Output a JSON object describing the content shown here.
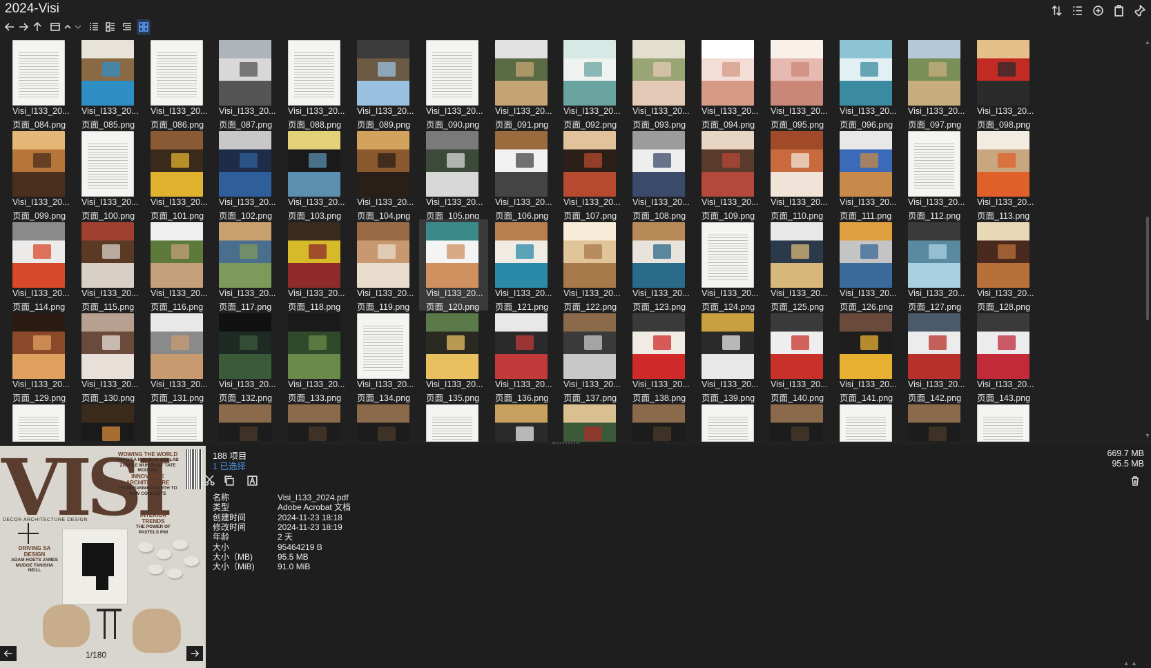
{
  "window": {
    "title": "2024-Visi"
  },
  "toolbar_icons": [
    "sort-icon",
    "details-view-icon",
    "add-icon",
    "clipboard-icon",
    "pin-icon"
  ],
  "nav_icons": [
    "back-icon",
    "forward-icon",
    "up-icon",
    "folder-icon",
    "chevron-up-icon",
    "chevron-down-icon",
    "list-view-icon",
    "tile-view-icon",
    "tree-view-icon",
    "thumbnail-view-icon"
  ],
  "grid": {
    "rows": [
      [
        {
          "name": "Visi_I133_20...",
          "sub": "页面_084.png",
          "kind": "doc"
        },
        {
          "name": "Visi_I133_20...",
          "sub": "页面_085.png",
          "kind": "pool"
        },
        {
          "name": "Visi_I133_20...",
          "sub": "页面_086.png",
          "kind": "doc"
        },
        {
          "name": "Visi_I133_20...",
          "sub": "页面_087.png",
          "kind": "cars"
        },
        {
          "name": "Visi_I133_20...",
          "sub": "页面_088.png",
          "kind": "doc2"
        },
        {
          "name": "Visi_I133_20...",
          "sub": "页面_089.png",
          "kind": "house"
        },
        {
          "name": "Visi_I133_20...",
          "sub": "页面_090.png",
          "kind": "doc"
        },
        {
          "name": "Visi_I133_20...",
          "sub": "页面_091.png",
          "kind": "aerial"
        },
        {
          "name": "Visi_I133_20...",
          "sub": "页面_092.png",
          "kind": "vases"
        },
        {
          "name": "Visi_I133_20...",
          "sub": "页面_093.png",
          "kind": "green"
        },
        {
          "name": "Visi_I133_20...",
          "sub": "页面_094.png",
          "kind": "pink"
        },
        {
          "name": "Visi_I133_20...",
          "sub": "页面_095.png",
          "kind": "pinkroom"
        },
        {
          "name": "Visi_I133_20...",
          "sub": "页面_096.png",
          "kind": "teal"
        },
        {
          "name": "Visi_I133_20...",
          "sub": "页面_097.png",
          "kind": "landscape"
        },
        {
          "name": "Visi_I133_20...",
          "sub": "页面_098.png",
          "kind": "red"
        }
      ],
      [
        {
          "name": "Visi_I133_20...",
          "sub": "页面_099.png",
          "kind": "warm"
        },
        {
          "name": "Visi_I133_20...",
          "sub": "页面_100.png",
          "kind": "doc"
        },
        {
          "name": "Visi_I133_20...",
          "sub": "页面_101.png",
          "kind": "yellowdesk"
        },
        {
          "name": "Visi_I133_20...",
          "sub": "页面_102.png",
          "kind": "blue"
        },
        {
          "name": "Visi_I133_20...",
          "sub": "页面_103.png",
          "kind": "fridge"
        },
        {
          "name": "Visi_I133_20...",
          "sub": "页面_104.png",
          "kind": "lounge"
        },
        {
          "name": "Visi_I133_20...",
          "sub": "页面_105.png",
          "kind": "stairs"
        },
        {
          "name": "Visi_I133_20...",
          "sub": "页面_106.png",
          "kind": "collage"
        },
        {
          "name": "Visi_I133_20...",
          "sub": "页面_107.png",
          "kind": "dining"
        },
        {
          "name": "Visi_I133_20...",
          "sub": "页面_108.png",
          "kind": "collage2"
        },
        {
          "name": "Visi_I133_20...",
          "sub": "页面_109.png",
          "kind": "bedroom"
        },
        {
          "name": "Visi_I133_20...",
          "sub": "页面_110.png",
          "kind": "terracotta"
        },
        {
          "name": "Visi_I133_20...",
          "sub": "页面_111.png",
          "kind": "sky"
        },
        {
          "name": "Visi_I133_20...",
          "sub": "页面_112.png",
          "kind": "doc"
        },
        {
          "name": "Visi_I133_20...",
          "sub": "页面_113.png",
          "kind": "orange"
        }
      ],
      [
        {
          "name": "Visi_I133_20...",
          "sub": "页面_114.png",
          "kind": "white"
        },
        {
          "name": "Visi_I133_20...",
          "sub": "页面_115.png",
          "kind": "living"
        },
        {
          "name": "Visi_I133_20...",
          "sub": "页面_116.png",
          "kind": "garden"
        },
        {
          "name": "Visi_I133_20...",
          "sub": "页面_117.png",
          "kind": "exterior"
        },
        {
          "name": "Visi_I133_20...",
          "sub": "页面_118.png",
          "kind": "yellowred"
        },
        {
          "name": "Visi_I133_20...",
          "sub": "页面_119.png",
          "kind": "wood"
        },
        {
          "name": "Visi_I133_20...",
          "sub": "页面_120.png",
          "kind": "collage3",
          "selected": true
        },
        {
          "name": "Visi_I133_20...",
          "sub": "页面_121.png",
          "kind": "bright"
        },
        {
          "name": "Visi_I133_20...",
          "sub": "页面_122.png",
          "kind": "spiral"
        },
        {
          "name": "Visi_I133_20...",
          "sub": "页面_123.png",
          "kind": "bluechairs"
        },
        {
          "name": "Visi_I133_20...",
          "sub": "页面_124.png",
          "kind": "doc"
        },
        {
          "name": "Visi_I133_20...",
          "sub": "页面_125.png",
          "kind": "round"
        },
        {
          "name": "Visi_I133_20...",
          "sub": "页面_126.png",
          "kind": "modern"
        },
        {
          "name": "Visi_I133_20...",
          "sub": "页面_127.png",
          "kind": "pool2"
        },
        {
          "name": "Visi_I133_20...",
          "sub": "页面_128.png",
          "kind": "shelves"
        }
      ],
      [
        {
          "name": "Visi_I133_20...",
          "sub": "页面_129.png",
          "kind": "corridor"
        },
        {
          "name": "Visi_I133_20...",
          "sub": "页面_130.png",
          "kind": "bath"
        },
        {
          "name": "Visi_I133_20...",
          "sub": "页面_131.png",
          "kind": "shower"
        },
        {
          "name": "Visi_I133_20...",
          "sub": "页面_132.png",
          "kind": "darkgarden"
        },
        {
          "name": "Visi_I133_20...",
          "sub": "页面_133.png",
          "kind": "trees"
        },
        {
          "name": "Visi_I133_20...",
          "sub": "页面_134.png",
          "kind": "doc"
        },
        {
          "name": "Visi_I133_20...",
          "sub": "页面_135.png",
          "kind": "night"
        },
        {
          "name": "Visi_I133_20...",
          "sub": "页面_136.png",
          "kind": "redfloor"
        },
        {
          "name": "Visi_I133_20...",
          "sub": "页面_137.png",
          "kind": "loft"
        },
        {
          "name": "Visi_I133_20...",
          "sub": "页面_138.png",
          "kind": "redstools"
        },
        {
          "name": "Visi_I133_20...",
          "sub": "页面_139.png",
          "kind": "loft2"
        },
        {
          "name": "Visi_I133_20...",
          "sub": "页面_140.png",
          "kind": "gallery"
        },
        {
          "name": "Visi_I133_20...",
          "sub": "页面_141.png",
          "kind": "spiral2"
        },
        {
          "name": "Visi_I133_20...",
          "sub": "页面_142.png",
          "kind": "collage4"
        },
        {
          "name": "Visi_I133_20...",
          "sub": "页面_143.png",
          "kind": "redbed"
        }
      ],
      [
        {
          "name": "",
          "sub": "",
          "kind": "doc"
        },
        {
          "name": "",
          "sub": "",
          "kind": "darkchandelier"
        },
        {
          "name": "",
          "sub": "",
          "kind": "doc"
        },
        {
          "name": "",
          "sub": "",
          "kind": "dark"
        },
        {
          "name": "",
          "sub": "",
          "kind": "dark"
        },
        {
          "name": "",
          "sub": "",
          "kind": "dark"
        },
        {
          "name": "",
          "sub": "",
          "kind": "doc"
        },
        {
          "name": "",
          "sub": "",
          "kind": "lamp"
        },
        {
          "name": "",
          "sub": "",
          "kind": "greenred"
        },
        {
          "name": "",
          "sub": "",
          "kind": "dark"
        },
        {
          "name": "",
          "sub": "",
          "kind": "doc"
        },
        {
          "name": "",
          "sub": "",
          "kind": "dark"
        },
        {
          "name": "",
          "sub": "",
          "kind": "doc"
        },
        {
          "name": "",
          "sub": "",
          "kind": "dark"
        },
        {
          "name": "",
          "sub": "",
          "kind": "doc"
        }
      ]
    ]
  },
  "preview": {
    "cover": {
      "logo": "VISI",
      "headline1": "WOWING THE WORLD",
      "headline1_sub": "THABISA MJO/DAG COLLAB ZANELE MUHOLI AT TATE MODERN",
      "headline2": "INNOVATIVE ARCHITECTURE",
      "headline2_sub": "FROM RAMMED EARTH TO RAW CONCRETE",
      "tagline": "DECOR ARCHITECTURE DESIGN",
      "headline3": "INTERIOR TRENDS",
      "headline3_sub": "THE POWER OF PASTELS P90",
      "headline4": "DRIVING SA DESIGN",
      "headline4_sub": "ADAM HOETS JAMES MUDGE TANISHA NEILL"
    },
    "page_counter": "1/180"
  },
  "info": {
    "item_count": "188 项目",
    "selected_count": "1 已选择",
    "total_size": "669.7 MB",
    "selected_size": "95.5 MB",
    "actions": [
      "cut-icon",
      "copy-icon",
      "rename-icon"
    ],
    "properties": [
      {
        "key": "名称",
        "value": "Visi_I133_2024.pdf"
      },
      {
        "key": "类型",
        "value": "Adobe Acrobat 文档"
      },
      {
        "key": "创建时间",
        "value": "2024-11-23  18:18"
      },
      {
        "key": "修改时间",
        "value": "2024-11-23  18:19"
      },
      {
        "key": "年龄",
        "value": "2 天"
      },
      {
        "key": "大小",
        "value": "95464219 B"
      },
      {
        "key": "大小（MB)",
        "value": "95.5 MB"
      },
      {
        "key": "大小（MiB)",
        "value": "91.0 MiB"
      }
    ]
  }
}
